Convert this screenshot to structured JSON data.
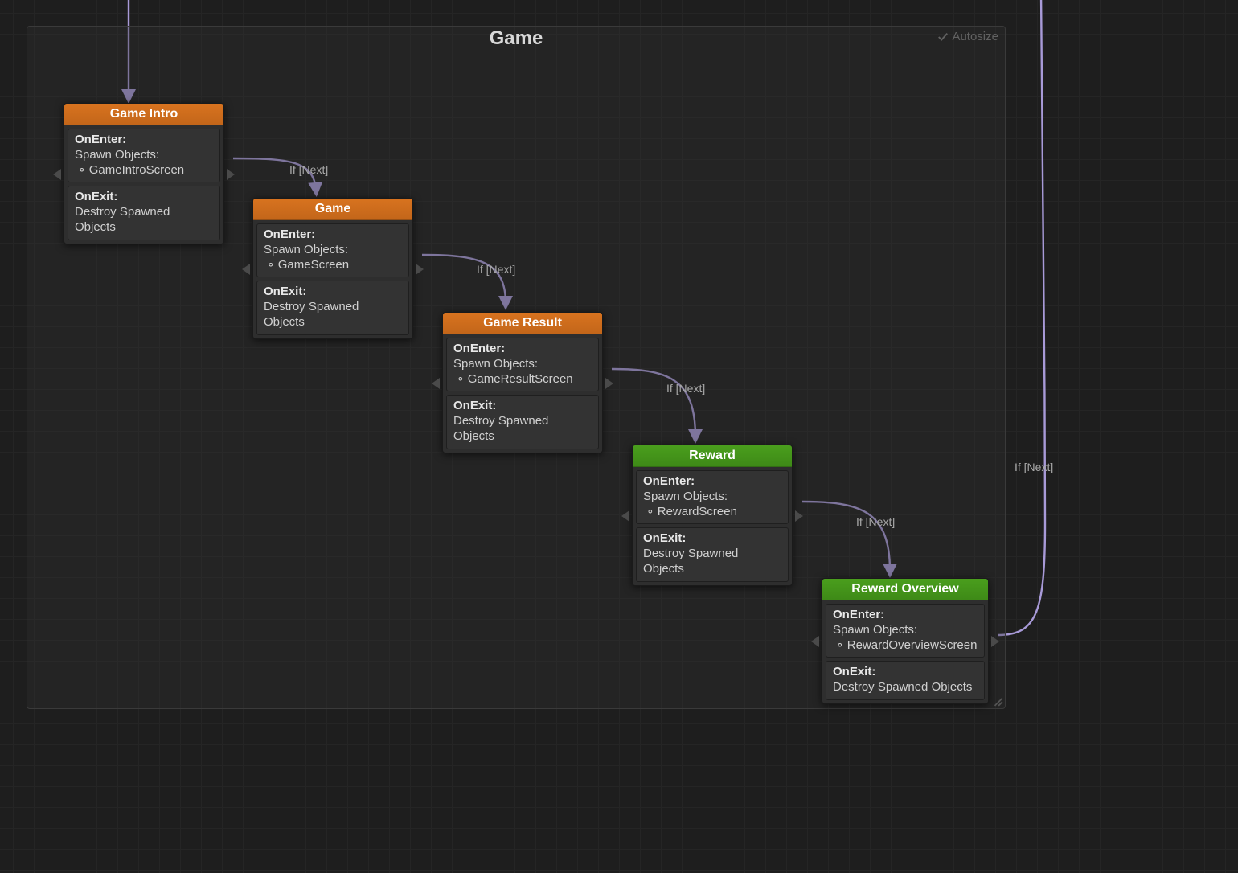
{
  "group": {
    "title": "Game",
    "autosize_label": "Autosize"
  },
  "edges": {
    "e1": "If [Next]",
    "e2": "If [Next]",
    "e3": "If [Next]",
    "e4": "If [Next]",
    "e5": "If [Next]"
  },
  "nodes": {
    "intro": {
      "title": "Game Intro",
      "on_enter_label": "OnEnter:",
      "spawn_label": "Spawn Objects:",
      "spawn_item": "GameIntroScreen",
      "on_exit_label": "OnExit:",
      "on_exit_text": "Destroy Spawned Objects"
    },
    "game": {
      "title": "Game",
      "on_enter_label": "OnEnter:",
      "spawn_label": "Spawn Objects:",
      "spawn_item": "GameScreen",
      "on_exit_label": "OnExit:",
      "on_exit_text": "Destroy Spawned Objects"
    },
    "result": {
      "title": "Game Result",
      "on_enter_label": "OnEnter:",
      "spawn_label": "Spawn Objects:",
      "spawn_item": "GameResultScreen",
      "on_exit_label": "OnExit:",
      "on_exit_text": "Destroy Spawned Objects"
    },
    "reward": {
      "title": "Reward",
      "on_enter_label": "OnEnter:",
      "spawn_label": "Spawn Objects:",
      "spawn_item": "RewardScreen",
      "on_exit_label": "OnExit:",
      "on_exit_text": "Destroy Spawned Objects"
    },
    "overview": {
      "title": "Reward Overview",
      "on_enter_label": "OnEnter:",
      "spawn_label": "Spawn Objects:",
      "spawn_item": "RewardOverviewScreen",
      "on_exit_label": "OnExit:",
      "on_exit_text": "Destroy Spawned Objects"
    }
  }
}
